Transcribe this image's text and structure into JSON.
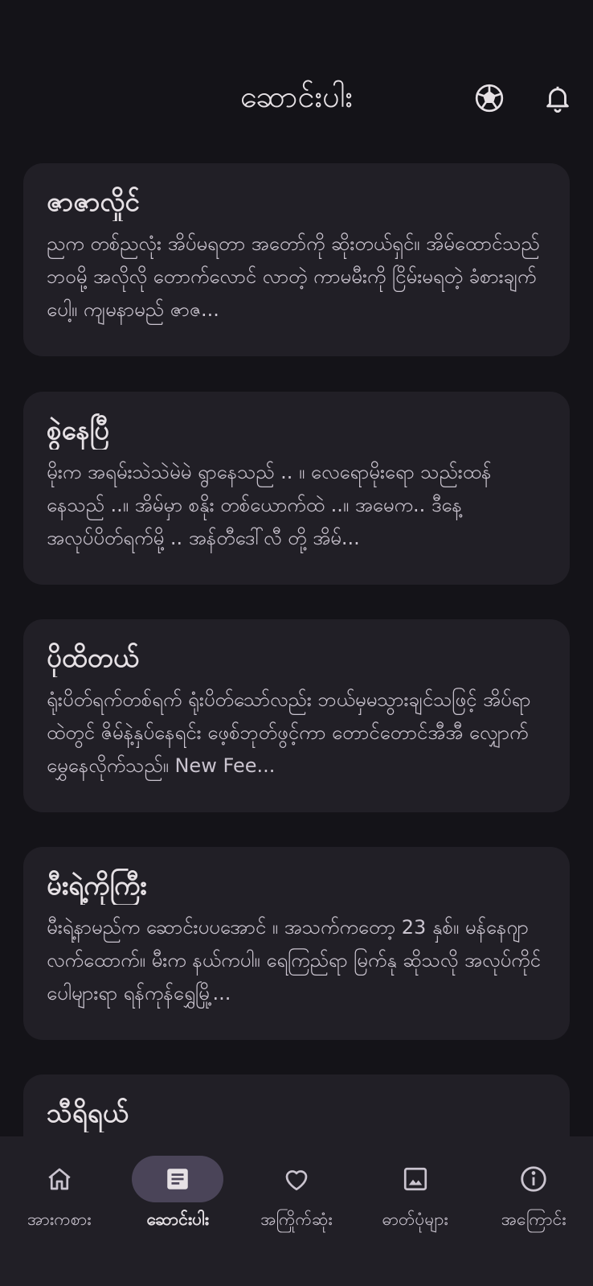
{
  "header": {
    "title": "ဆောင်းပါး"
  },
  "articles": [
    {
      "title": "ဇာဇာလှိုင်",
      "excerpt": "ညက တစ်ညလုံး အိပ်မရတာ အတော်ကို ဆိုးတယ်ရှင်။ အိမ်ထောင်သည် ဘဝမို့ အလိုလို တောက်လောင် လာတဲ့ ကာမမီးကို ငြိမ်းမရတဲ့ ခံစားချက်ပေါ့။ ကျမနာမည် ဇာဇ..."
    },
    {
      "title": "စွဲနေပြီ",
      "excerpt": "မိုးက အရမ်းသဲသဲမဲမဲ ရွာနေသည် .. ။ လေရောမိုးရော သည်းထန်နေသည် ..။ အိမ်မှာ စနိုး တစ်ယောက်ထဲ ..။ အမေက.. ဒီနေ့ အလုပ်ပိတ်ရက်မို့ .. အန်တီဒေါ်လီ တို့ အိမ်..."
    },
    {
      "title": "ပိုထိတယ်",
      "excerpt": "ရုံးပိတ်ရက်တစ်ရက် ရုံးပိတ်သော်လည်း ဘယ်မှမသွားချင်သဖြင့် အိပ်ရာထဲတွင် ဇိမ်နဲ့နှပ်နေရင်း ဖေ့စ်ဘုတ်ဖွင့်ကာ တောင်တောင်အီအီ လျှောက်မွှေနေလိုက်သည်။ New Fee..."
    },
    {
      "title": "မီးရဲ့ကိုကြီး",
      "excerpt": "မီးရဲ့နာမည်က ဆောင်းပပအောင် ။ အသက်ကတော့ 23 နှစ်။ မန်နေဂျာလက်ထောက်။ မီးက နယ်ကပါ။ ရေကြည်ရာ မြက်နု ဆိုသလို အလုပ်ကိုင် ပေါများရာ ရန်ကုန်ရွှေမြို့..."
    },
    {
      "title": "သီရိရယ်",
      "excerpt": ""
    }
  ],
  "bottom_nav": {
    "items": [
      {
        "label": "အားကစား",
        "icon": "home-icon"
      },
      {
        "label": "ဆောင်းပါး",
        "icon": "article-icon",
        "active": true
      },
      {
        "label": "အကြိုက်ဆုံး",
        "icon": "heart-icon"
      },
      {
        "label": "ဓာတ်ပုံများ",
        "icon": "image-icon"
      },
      {
        "label": "အကြောင်း",
        "icon": "info-icon"
      }
    ]
  },
  "colors": {
    "background": "#141318",
    "card": "#211f26",
    "nav_active_pill": "#4a4458",
    "text_primary": "#e6e1e5",
    "text_secondary": "#cac4cf"
  }
}
